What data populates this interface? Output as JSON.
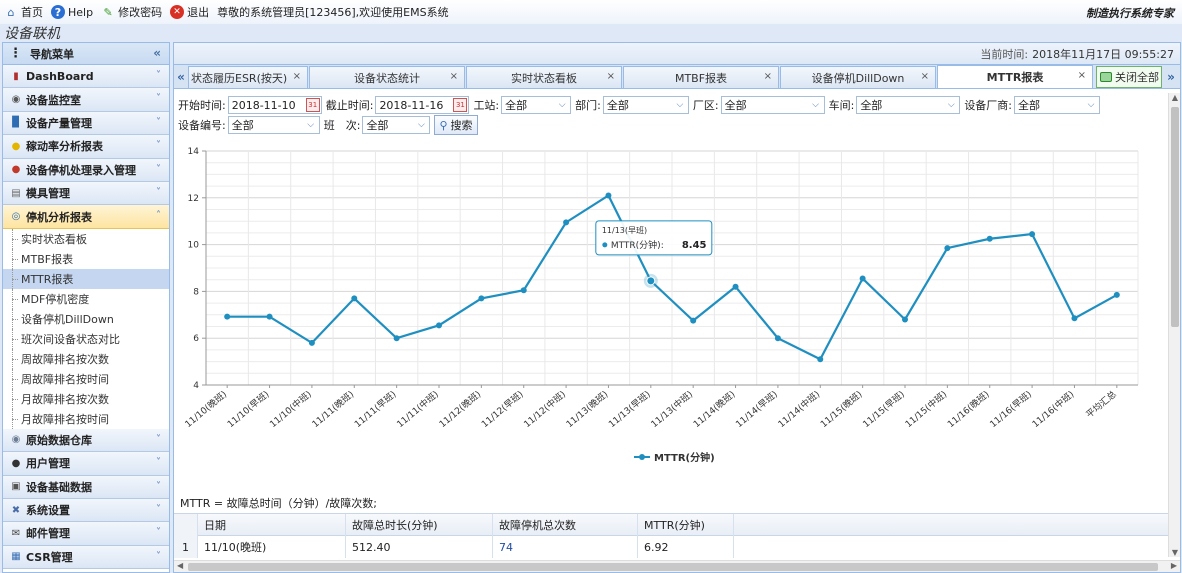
{
  "topbar": {
    "items": [
      {
        "label": "首页",
        "icon": "home-icon"
      },
      {
        "label": "Help",
        "icon": "help-icon"
      },
      {
        "label": "修改密码",
        "icon": "pencil-icon"
      },
      {
        "label": "退出",
        "icon": "exit-icon"
      }
    ],
    "welcome": "尊敬的系统管理员[123456],欢迎使用EMS系统",
    "slogan": "制造执行系统专家"
  },
  "app_subtitle": "设备联机",
  "sidebar": {
    "title": "导航菜单",
    "groups_top": [
      {
        "label": "DashBoard",
        "icon": "dashboard-icon"
      },
      {
        "label": "设备监控室",
        "icon": "monitor-icon"
      },
      {
        "label": "设备产量管理",
        "icon": "bar-chart-icon"
      },
      {
        "label": "稼动率分析报表",
        "icon": "bulb-icon"
      },
      {
        "label": "设备停机处理录入管理",
        "icon": "pill-icon"
      },
      {
        "label": "模具管理",
        "icon": "mold-icon"
      },
      {
        "label": "停机分析报表",
        "icon": "stop-analysis-icon"
      }
    ],
    "subitems": [
      "实时状态看板",
      "MTBF报表",
      "MTTR报表",
      "MDF停机密度",
      "设备停机DillDown",
      "班次间设备状态对比",
      "周故障排名按次数",
      "周故障排名按时间",
      "月故障排名按次数",
      "月故障排名按时间"
    ],
    "selected_sub": "MTTR报表",
    "groups_bottom": [
      {
        "label": "原始数据仓库",
        "icon": "database-icon"
      },
      {
        "label": "用户管理",
        "icon": "user-icon"
      },
      {
        "label": "设备基础数据",
        "icon": "settings-doc-icon"
      },
      {
        "label": "系统设置",
        "icon": "tools-icon"
      },
      {
        "label": "邮件管理",
        "icon": "mail-icon"
      },
      {
        "label": "CSR管理",
        "icon": "csr-icon"
      }
    ]
  },
  "timebar": {
    "label": "当前时间:",
    "value": "2018年11月17日 09:55:27"
  },
  "tabs": [
    {
      "label": "状态履历ESR(按天)",
      "active": false
    },
    {
      "label": "设备状态统计",
      "active": false
    },
    {
      "label": "实时状态看板",
      "active": false
    },
    {
      "label": "MTBF报表",
      "active": false
    },
    {
      "label": "设备停机DillDown",
      "active": false
    },
    {
      "label": "MTTR报表",
      "active": true
    }
  ],
  "close_all": "关闭全部",
  "filters": {
    "start_label": "开始时间:",
    "start_value": "2018-11-10",
    "end_label": "截止时间:",
    "end_value": "2018-11-16",
    "station_label": "工站:",
    "station_value": "全部",
    "dept_label": "部门:",
    "dept_value": "全部",
    "plant_label": "厂区:",
    "plant_value": "全部",
    "workshop_label": "车间:",
    "workshop_value": "全部",
    "maker_label": "设备厂商:",
    "maker_value": "全部",
    "device_label": "设备编号:",
    "device_value": "全部",
    "shift_label": "班　次:",
    "shift_value": "全部",
    "search": "搜索"
  },
  "chart_data": {
    "type": "line",
    "categories": [
      "11/10(晚班)",
      "11/10(早班)",
      "11/10(中班)",
      "11/11(晚班)",
      "11/11(早班)",
      "11/11(中班)",
      "11/12(晚班)",
      "11/12(早班)",
      "11/12(中班)",
      "11/13(晚班)",
      "11/13(早班)",
      "11/13(中班)",
      "11/14(晚班)",
      "11/14(早班)",
      "11/14(中班)",
      "11/15(晚班)",
      "11/15(早班)",
      "11/15(中班)",
      "11/16(晚班)",
      "11/16(早班)",
      "11/16(中班)",
      "平均汇总"
    ],
    "series": [
      {
        "name": "MTTR(分钟)",
        "values": [
          6.92,
          6.92,
          5.8,
          7.7,
          6.0,
          6.55,
          7.7,
          8.05,
          10.95,
          12.1,
          8.45,
          6.75,
          8.2,
          6.0,
          5.1,
          8.55,
          6.8,
          9.85,
          10.25,
          10.45,
          6.85,
          7.85
        ],
        "color": "#1f8fc0"
      }
    ],
    "ylim": [
      4,
      14
    ],
    "yticks": [
      4,
      6,
      8,
      10,
      12,
      14
    ],
    "grid": true,
    "legend": "bottom",
    "tooltip": {
      "title": "11/13(早班)",
      "label": "MTTR(分钟):",
      "value": "8.45",
      "index": 10
    }
  },
  "formula": "MTTR = 故障总时间（分钟）/故障次数;",
  "table": {
    "headers": [
      "日期",
      "故障总时长(分钟)",
      "故障停机总次数",
      "MTTR(分钟)"
    ],
    "rows": [
      {
        "n": "1",
        "date": "11/10(晚班)",
        "total": "512.40",
        "count": "74",
        "mttr": "6.92"
      }
    ]
  }
}
